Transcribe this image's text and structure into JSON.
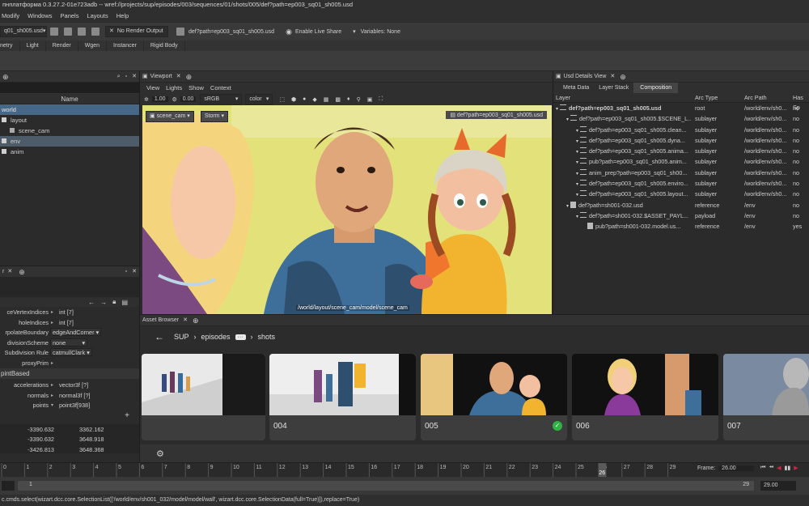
{
  "title": "пнплатформа 0.3.27.2-01e723adb -- wref://projects/sup/episodes/003/sequences/01/shots/005/def?path=ep003_sq01_sh005.usd",
  "menu": [
    "Modify",
    "Windows",
    "Panels",
    "Layouts",
    "Help"
  ],
  "toolbar": {
    "file_combo": "q01_sh005.usd",
    "render_output": "No Render Output",
    "current_layer": "def?path=ep003_sq01_sh005.usd",
    "live_share": "Enable Live Share",
    "variables": "Variables: None"
  },
  "shelf_tabs": [
    "netry",
    "Light",
    "Render",
    "Wgen",
    "Instancer",
    "Rigid Body"
  ],
  "outliner": {
    "column": "Name",
    "root": "world",
    "items": [
      "layout",
      "scene_cam",
      "env",
      "anim"
    ]
  },
  "attributes": {
    "header": "r",
    "rows": [
      {
        "name": "ceVertexIndices",
        "value": "int [7]"
      },
      {
        "name": "holeIndices",
        "value": "int [7]"
      },
      {
        "name": "rpolateBoundary",
        "value": "edgeAndCorner"
      },
      {
        "name": "divisionScheme",
        "value": "none"
      },
      {
        "name": "Subdivision Rule",
        "value": "catmullClark"
      },
      {
        "name": "proxyPrim",
        "value": ""
      }
    ],
    "section": "pintBased",
    "rows2": [
      {
        "name": "accelerations",
        "value": "vector3f [?]"
      },
      {
        "name": "normals",
        "value": "normal3f [?]"
      },
      {
        "name": "points",
        "value": "point3f[938]"
      }
    ],
    "table": [
      [
        "-3390.632",
        "3362.162"
      ],
      [
        "-3390.632",
        "3648.918"
      ],
      [
        "-3426.813",
        "3648.368"
      ]
    ]
  },
  "viewport": {
    "tab": "Viewport",
    "menu": [
      "View",
      "Lights",
      "Show",
      "Context"
    ],
    "exposure": "1.00",
    "gamma": "0.00",
    "colorspace": "sRGB",
    "channel": "color",
    "camera": "scene_cam",
    "shading": "Storm",
    "layer_badge": "def?path=ep003_sq01_sh005.usd",
    "hud_path": "/world/layout/scene_cam/model/scene_cam"
  },
  "usd": {
    "tab": "Usd Details View",
    "subtabs": [
      "Meta Data",
      "Layer Stack",
      "Composition"
    ],
    "columns": [
      "Layer",
      "Arc Type",
      "Arc Path",
      "Has Sp"
    ],
    "rows": [
      {
        "layer": "def?path=ep003_sq01_sh005.usd",
        "arc": "root",
        "path": "/world/env/sh0...",
        "has": "no",
        "indent": 0
      },
      {
        "layer": "def?path=ep003_sq01_sh005.$SCENE_L...",
        "arc": "sublayer",
        "path": "/world/env/sh0...",
        "has": "no",
        "indent": 1
      },
      {
        "layer": "def?path=ep003_sq01_sh005.clean...",
        "arc": "sublayer",
        "path": "/world/env/sh0...",
        "has": "no",
        "indent": 2
      },
      {
        "layer": "def?path=ep003_sq01_sh005.dyna...",
        "arc": "sublayer",
        "path": "/world/env/sh0...",
        "has": "no",
        "indent": 2
      },
      {
        "layer": "def?path=ep003_sq01_sh005.anima...",
        "arc": "sublayer",
        "path": "/world/env/sh0...",
        "has": "no",
        "indent": 2
      },
      {
        "layer": "pub?path=ep003_sq01_sh005.anim...",
        "arc": "sublayer",
        "path": "/world/env/sh0...",
        "has": "no",
        "indent": 2
      },
      {
        "layer": "anim_prep?path=ep003_sq01_sh00...",
        "arc": "sublayer",
        "path": "/world/env/sh0...",
        "has": "no",
        "indent": 2
      },
      {
        "layer": "def?path=ep003_sq01_sh005.enviro...",
        "arc": "sublayer",
        "path": "/world/env/sh0...",
        "has": "no",
        "indent": 2
      },
      {
        "layer": "def?path=ep003_sq01_sh005.layout...",
        "arc": "sublayer",
        "path": "/world/env/sh0...",
        "has": "no",
        "indent": 2
      },
      {
        "layer": "def?path=sh001-032.usd",
        "arc": "reference",
        "path": "/env",
        "has": "no",
        "indent": 1
      },
      {
        "layer": "def?path=sh001-032.$ASSET_PAYL...",
        "arc": "payload",
        "path": "/env",
        "has": "no",
        "indent": 2
      },
      {
        "layer": "pub?path=sh001-032.model.us...",
        "arc": "reference",
        "path": "/env",
        "has": "yes",
        "indent": 3
      }
    ]
  },
  "asset_browser": {
    "tab": "Asset Browser",
    "breadcrumb": [
      "SUP",
      "episodes",
      "shots"
    ],
    "ellipsis": "···",
    "cards": [
      "",
      "004",
      "005",
      "006",
      "007"
    ]
  },
  "timeline": {
    "ticks": [
      "0",
      "1",
      "2",
      "3",
      "4",
      "5",
      "6",
      "7",
      "8",
      "9",
      "10",
      "11",
      "12",
      "13",
      "14",
      "15",
      "16",
      "17",
      "18",
      "19",
      "20",
      "21",
      "22",
      "23",
      "24",
      "25",
      "26",
      "27",
      "28",
      "29"
    ],
    "current": "26",
    "frame_label": "Frame:",
    "frame_value": "26.00",
    "range_start": "1",
    "range_end": "29",
    "end_value": "29.00"
  },
  "status": "c.cmds.select(wizart.dcc.core.SelectionList(['/world/env/sh001_032/model/model/wall', wizart.dcc.core.SelectionData(full=True)]),replace=True)"
}
